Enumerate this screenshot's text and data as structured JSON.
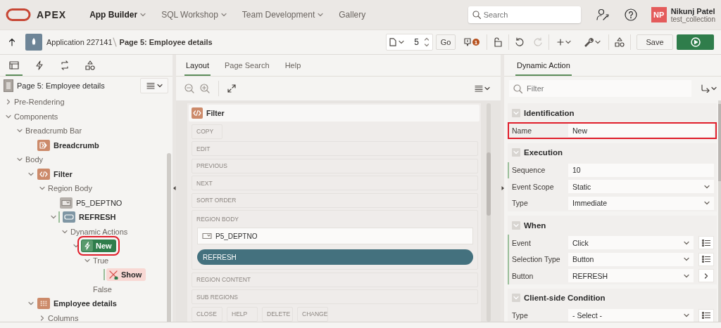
{
  "header": {
    "product": "APEX",
    "nav": [
      {
        "label": "App Builder",
        "selected": true,
        "menu": true
      },
      {
        "label": "SQL Workshop",
        "selected": false,
        "menu": true
      },
      {
        "label": "Team Development",
        "selected": false,
        "menu": true
      },
      {
        "label": "Gallery",
        "selected": false,
        "menu": false
      }
    ],
    "search": {
      "placeholder": "Search"
    },
    "user": {
      "initials": "NP",
      "name": "Nikunj Patel",
      "workspace": "test_collection"
    }
  },
  "toolbar": {
    "breadcrumb": [
      "Application 227141",
      "Page 5: Employee details"
    ],
    "page_number": "5",
    "go": "Go",
    "issues": "1",
    "redo": {
      "disabled": true
    },
    "save": "Save"
  },
  "tree_tabs": [
    {
      "kind": "rendering",
      "selected": true
    },
    {
      "kind": "dynamic-actions",
      "selected": false
    },
    {
      "kind": "processing",
      "selected": false
    },
    {
      "kind": "shared",
      "selected": false
    }
  ],
  "page_node": "Page 5: Employee details",
  "tree": [
    {
      "label": "Pre-Rendering",
      "kind": "group",
      "expanded": false,
      "selected": false
    },
    {
      "label": "Components",
      "kind": "group",
      "expanded": true,
      "selected": false,
      "children": [
        {
          "label": "Breadcrumb Bar",
          "kind": "group",
          "expanded": true,
          "selected": false,
          "children": [
            {
              "label": "Breadcrumb",
              "kind": "breadcrumb",
              "selected": false
            }
          ]
        },
        {
          "label": "Body",
          "kind": "group",
          "expanded": true,
          "selected": false,
          "children": [
            {
              "label": "Filter",
              "kind": "region",
              "expanded": true,
              "selected": false,
              "children": [
                {
                  "label": "Region Body",
                  "kind": "group",
                  "expanded": true,
                  "selected": false,
                  "children": [
                    {
                      "label": "P5_DEPTNO",
                      "kind": "item",
                      "selected": false
                    },
                    {
                      "label": "REFRESH",
                      "kind": "button",
                      "expanded": true,
                      "selected": false,
                      "flagged": true,
                      "children": [
                        {
                          "label": "Dynamic Actions",
                          "kind": "group",
                          "expanded": true,
                          "selected": false,
                          "children": [
                            {
                              "label": "New",
                              "kind": "dynamic-action",
                              "expanded": true,
                              "selected": true,
                              "highlighted": true,
                              "children": [
                                {
                                  "label": "True",
                                  "kind": "group",
                                  "expanded": true,
                                  "selected": false,
                                  "children": [
                                    {
                                      "label": "Show",
                                      "kind": "action",
                                      "selected": false,
                                      "flagged": true
                                    }
                                  ]
                                },
                                {
                                  "label": "False",
                                  "kind": "group",
                                  "selected": false
                                }
                              ]
                            }
                          ]
                        }
                      ]
                    }
                  ]
                }
              ]
            },
            {
              "label": "Employee details",
              "kind": "report",
              "expanded": true,
              "selected": false,
              "children": [
                {
                  "label": "Columns",
                  "kind": "group",
                  "expanded": false,
                  "selected": false
                }
              ]
            }
          ]
        }
      ]
    }
  ],
  "layout_tabs": [
    {
      "label": "Layout",
      "selected": true
    },
    {
      "label": "Page Search",
      "selected": false
    },
    {
      "label": "Help",
      "selected": false
    }
  ],
  "canvas": {
    "region": "Filter",
    "positions": [
      {
        "label": "COPY",
        "kind": "small"
      },
      {
        "label": "EDIT",
        "kind": "wide"
      },
      {
        "label": "PREVIOUS",
        "kind": "wide"
      },
      {
        "label": "NEXT",
        "kind": "wide"
      },
      {
        "label": "SORT ORDER",
        "kind": "wide"
      },
      {
        "label": "REGION BODY",
        "kind": "wide",
        "components": [
          {
            "kind": "item",
            "label": "P5_DEPTNO"
          },
          {
            "kind": "button",
            "label": "REFRESH"
          }
        ]
      },
      {
        "label": "REGION CONTENT",
        "kind": "wide"
      },
      {
        "label": "SUB REGIONS",
        "kind": "wide"
      },
      {
        "label": "CLOSE",
        "kind": "small"
      },
      {
        "label": "HELP",
        "kind": "small"
      },
      {
        "label": "DELETE",
        "kind": "small"
      },
      {
        "label": "CHANGE",
        "kind": "small"
      }
    ]
  },
  "property_tabs": [
    {
      "label": "Dynamic Action",
      "selected": true
    }
  ],
  "filter": {
    "placeholder": "Filter"
  },
  "sections": [
    {
      "title": "Identification",
      "expanded": true,
      "properties": [
        {
          "label": "Name",
          "value": "New",
          "kind": "text",
          "required": false,
          "highlighted": true
        }
      ]
    },
    {
      "title": "Execution",
      "expanded": true,
      "properties": [
        {
          "label": "Sequence",
          "value": "10",
          "kind": "text",
          "required": true
        },
        {
          "label": "Event Scope",
          "value": "Static",
          "kind": "select",
          "required": false
        },
        {
          "label": "Type",
          "value": "Immediate",
          "kind": "select",
          "required": false
        }
      ]
    },
    {
      "title": "When",
      "expanded": true,
      "properties": [
        {
          "label": "Event",
          "value": "Click",
          "kind": "select",
          "required": true,
          "side_button": {
            "kind": "list"
          }
        },
        {
          "label": "Selection Type",
          "value": "Button",
          "kind": "select",
          "required": true,
          "side_button": {
            "kind": "list"
          }
        },
        {
          "label": "Button",
          "value": "REFRESH",
          "kind": "select",
          "required": true,
          "side_button": {
            "kind": "go"
          }
        }
      ]
    },
    {
      "title": "Client-side Condition",
      "expanded": true,
      "properties": [
        {
          "label": "Type",
          "value": "- Select -",
          "kind": "select",
          "required": false,
          "side_button": {
            "kind": "list"
          }
        }
      ]
    }
  ]
}
